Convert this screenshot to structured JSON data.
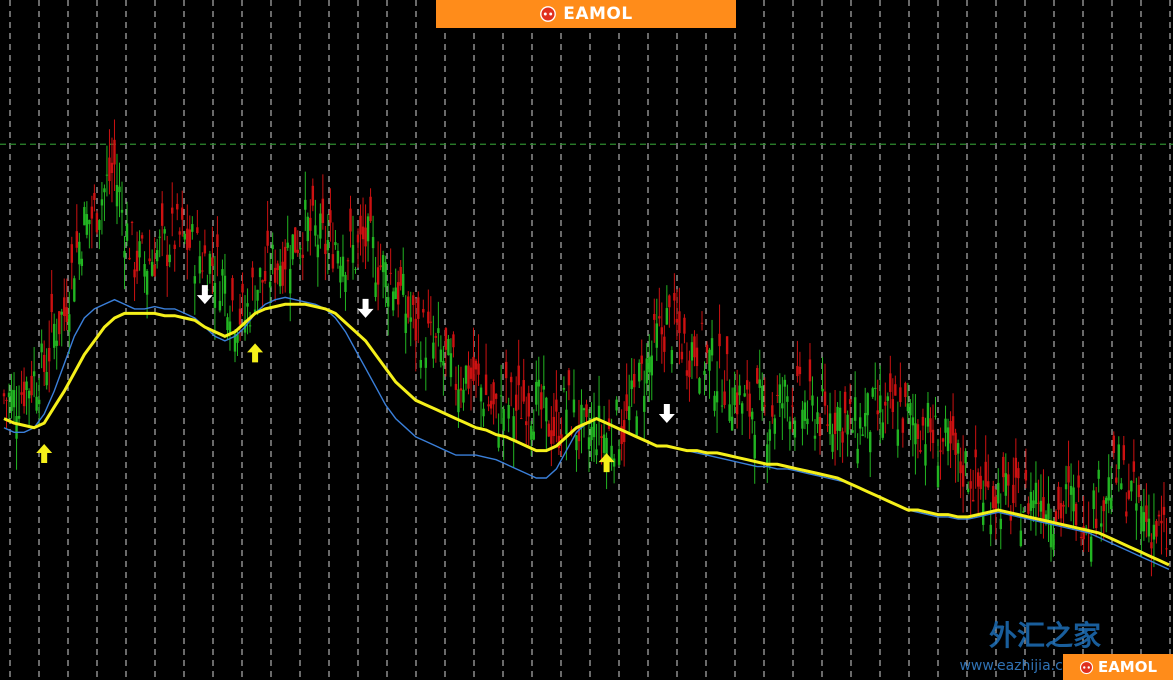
{
  "banner": {
    "brand": "EAMOL",
    "color": "#ff8c1a",
    "icon": "robot-logo-icon"
  },
  "watermark": {
    "text": "外汇之家",
    "url": "www.eazhijia.com"
  },
  "corner_badge": {
    "brand": "EAMOL"
  },
  "chart_data": {
    "type": "candlestick",
    "background": "#000000",
    "grid": "vertical-dashed",
    "colors": {
      "bull": "#22b522",
      "bear": "#cc1111",
      "fast_ma": "#3a7fd9",
      "slow_ma": "#f5f01a",
      "arrow_buy": "#f5f01a",
      "arrow_sell": "#ffffff",
      "level": "#2e8b2e"
    },
    "x": [
      0,
      1,
      2,
      3,
      4,
      5,
      6,
      7,
      8,
      9,
      10,
      11,
      12,
      13,
      14,
      15,
      16,
      17,
      18,
      19,
      20,
      21,
      22,
      23,
      24,
      25,
      26,
      27,
      28,
      29,
      30,
      31,
      32,
      33,
      34,
      35,
      36,
      37,
      38,
      39,
      40,
      41,
      42,
      43,
      44,
      45,
      46,
      47,
      48,
      49,
      50,
      51,
      52,
      53,
      54,
      55,
      56,
      57,
      58,
      59,
      60,
      61,
      62,
      63,
      64,
      65,
      66,
      67,
      68,
      69,
      70,
      71,
      72,
      73,
      74,
      75,
      76,
      77,
      78,
      79,
      80,
      81,
      82,
      83,
      84,
      85,
      86,
      87,
      88,
      89,
      90,
      91,
      92,
      93,
      94,
      95,
      96,
      97,
      98,
      99,
      100,
      101,
      102,
      103,
      104,
      105,
      106,
      107,
      108,
      109,
      110,
      111,
      112,
      113,
      114,
      115,
      116
    ],
    "price_close": [
      60,
      58,
      64,
      68,
      72,
      90,
      96,
      120,
      135,
      140,
      150,
      160,
      135,
      120,
      118,
      122,
      125,
      130,
      128,
      124,
      120,
      118,
      110,
      98,
      94,
      108,
      112,
      118,
      122,
      128,
      134,
      130,
      126,
      128,
      124,
      122,
      128,
      120,
      114,
      110,
      98,
      90,
      86,
      80,
      74,
      68,
      70,
      66,
      60,
      50,
      58,
      54,
      60,
      56,
      50,
      45,
      56,
      48,
      40,
      46,
      42,
      46,
      48,
      62,
      72,
      84,
      92,
      88,
      80,
      82,
      76,
      70,
      66,
      60,
      54,
      56,
      50,
      56,
      60,
      58,
      54,
      52,
      50,
      54,
      48,
      46,
      50,
      52,
      50,
      54,
      50,
      48,
      46,
      40,
      36,
      30,
      28,
      20,
      16,
      18,
      14,
      12,
      16,
      18,
      14,
      10,
      14,
      12,
      8,
      16,
      20,
      26,
      18,
      10,
      6,
      0,
      -4
    ],
    "ma_slow": [
      50,
      48,
      47,
      46,
      48,
      55,
      62,
      70,
      78,
      84,
      90,
      94,
      96,
      96,
      96,
      96,
      95,
      95,
      94,
      93,
      90,
      88,
      86,
      88,
      92,
      96,
      98,
      99,
      100,
      100,
      100,
      99,
      98,
      96,
      92,
      88,
      84,
      78,
      72,
      66,
      62,
      58,
      56,
      54,
      52,
      50,
      48,
      46,
      45,
      43,
      42,
      40,
      38,
      36,
      36,
      38,
      42,
      46,
      48,
      50,
      48,
      46,
      44,
      42,
      40,
      38,
      38,
      37,
      36,
      36,
      35,
      35,
      34,
      33,
      32,
      31,
      30,
      30,
      29,
      28,
      27,
      26,
      25,
      24,
      22,
      20,
      18,
      16,
      14,
      12,
      10,
      10,
      9,
      8,
      8,
      7,
      7,
      8,
      9,
      10,
      9,
      8,
      7,
      6,
      5,
      4,
      3,
      2,
      1,
      0,
      -2,
      -4,
      -6,
      -8,
      -10,
      -12,
      -14
    ],
    "ma_fast": [
      46,
      44,
      44,
      46,
      52,
      62,
      74,
      86,
      94,
      98,
      100,
      102,
      100,
      98,
      98,
      99,
      98,
      98,
      96,
      94,
      90,
      86,
      84,
      86,
      90,
      96,
      100,
      102,
      103,
      102,
      101,
      100,
      98,
      94,
      88,
      80,
      72,
      64,
      56,
      50,
      46,
      42,
      40,
      38,
      36,
      34,
      34,
      34,
      33,
      32,
      30,
      28,
      26,
      24,
      24,
      28,
      36,
      44,
      48,
      50,
      48,
      46,
      44,
      42,
      40,
      38,
      38,
      37,
      36,
      35,
      34,
      33,
      32,
      31,
      30,
      29,
      29,
      28,
      28,
      27,
      26,
      25,
      24,
      23,
      22,
      20,
      18,
      16,
      14,
      12,
      10,
      9,
      8,
      7,
      7,
      6,
      6,
      7,
      8,
      9,
      8,
      7,
      6,
      5,
      4,
      3,
      2,
      1,
      0,
      -2,
      -4,
      -6,
      -8,
      -10,
      -12,
      -14,
      -16
    ],
    "level": 170,
    "ylim": [
      -60,
      220
    ],
    "signals": [
      {
        "type": "buy",
        "index": 4
      },
      {
        "type": "sell",
        "index": 20
      },
      {
        "type": "buy",
        "index": 25
      },
      {
        "type": "sell",
        "index": 36
      },
      {
        "type": "buy",
        "index": 60
      },
      {
        "type": "sell",
        "index": 66
      }
    ]
  }
}
